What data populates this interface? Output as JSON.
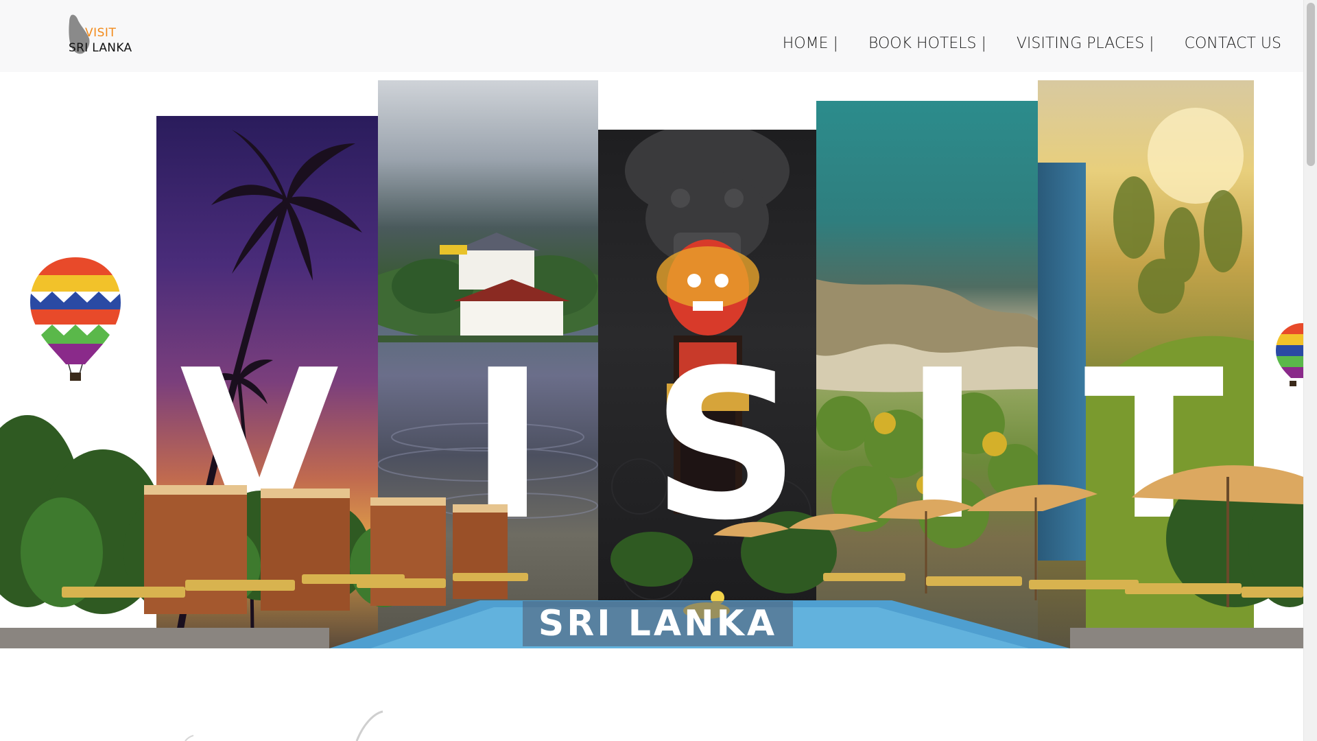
{
  "logo": {
    "line1": "VISIT",
    "line2": "SRI LANKA"
  },
  "nav": {
    "items": [
      {
        "label": "HOME |"
      },
      {
        "label": "BOOK HOTELS |"
      },
      {
        "label": "VISITING PLACES |"
      },
      {
        "label": "CONTACT US"
      }
    ]
  },
  "hero": {
    "letters": [
      "V",
      "I",
      "S",
      "I",
      "T"
    ],
    "subtitle": "SRI LANKA"
  },
  "colors": {
    "logo_accent": "#f28a1a",
    "nav_bg": "#f8f8f9",
    "text": "#1a1a1a"
  }
}
